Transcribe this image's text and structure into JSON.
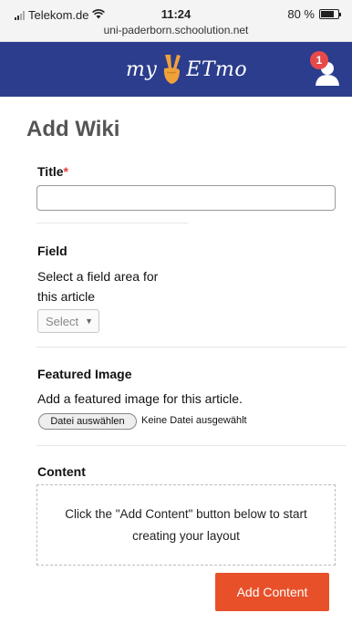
{
  "status_bar": {
    "carrier": "Telekom.de",
    "time": "11:24",
    "url": "uni-paderborn.schoolution.net",
    "battery": "80 %",
    "battery_level": 0.8
  },
  "app_bar": {
    "logo_text_left": "my",
    "logo_text_right": "ETmo",
    "notification_count": "1",
    "brand_color": "#2b3d8c",
    "badge_color": "#e84a4a"
  },
  "page": {
    "title": "Add Wiki"
  },
  "form": {
    "title_field": {
      "label": "Title",
      "required_mark": "*",
      "value": ""
    },
    "field_field": {
      "label": "Field",
      "description_line1": "Select a field area for",
      "description_line2": "this article",
      "select_value": "Select"
    },
    "featured_image": {
      "label": "Featured Image",
      "description": "Add a featured image for this article.",
      "choose_button": "Datei auswählen",
      "file_status": "Keine Datei ausgewählt"
    },
    "content": {
      "label": "Content",
      "placeholder_line1": "Click the \"Add Content\" button below to start",
      "placeholder_line2": "creating your layout",
      "add_button": "Add Content",
      "accent_color": "#e8502a"
    }
  },
  "icons": [
    "signal-icon",
    "wifi-icon",
    "battery-icon",
    "peace-hand-logo-icon",
    "user-icon",
    "chevron-down-icon"
  ]
}
